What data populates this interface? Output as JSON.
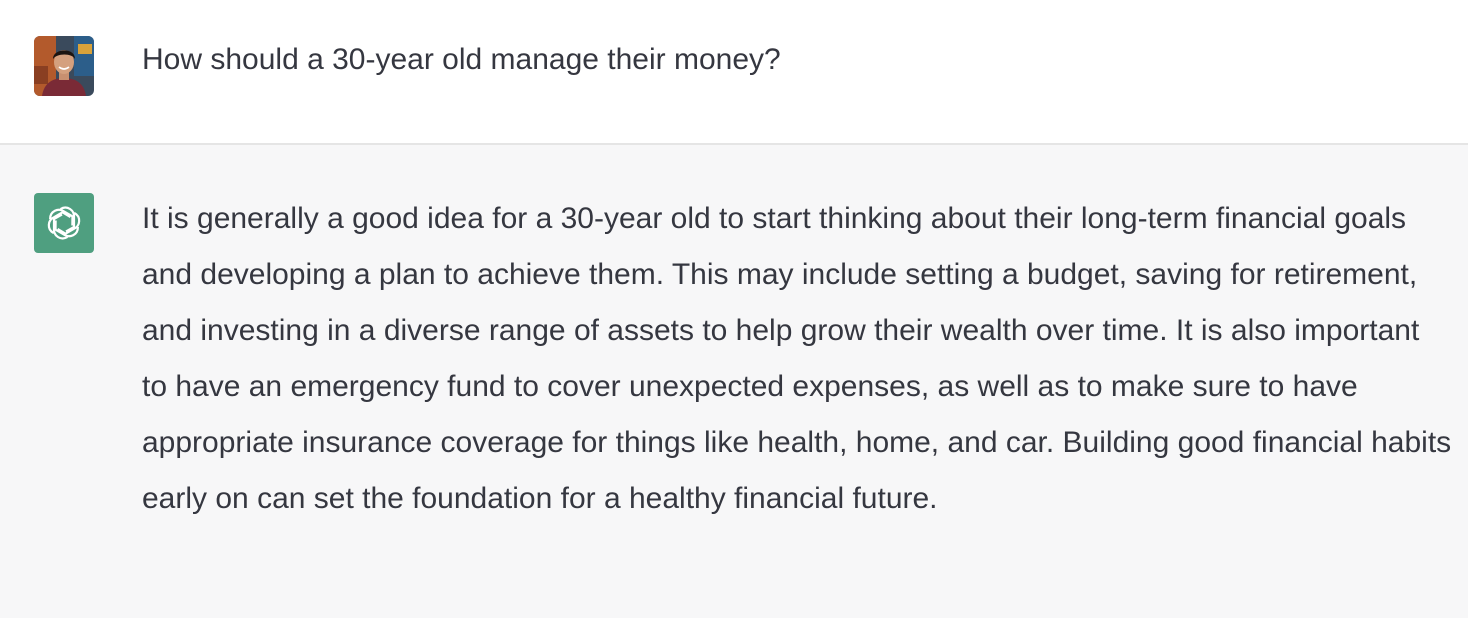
{
  "conversation": {
    "user_message": {
      "avatar": "user-avatar-photo",
      "text": "How should a 30-year old manage their money?"
    },
    "assistant_message": {
      "icon": "openai-logo-icon",
      "icon_bg_color": "#4f9f80",
      "text": "It is generally a good idea for a 30-year old to start thinking about their long-term financial goals and developing a plan to achieve them. This may include setting a budget, saving for retirement, and investing in a diverse range of assets to help grow their wealth over time. It is also important to have an emergency fund to cover unexpected expenses, as well as to make sure to have appropriate insurance coverage for things like health, home, and car. Building good financial habits early on can set the foundation for a healthy financial future."
    }
  },
  "colors": {
    "user_bg": "#ffffff",
    "assistant_bg": "#f7f7f8",
    "text": "#353740",
    "divider": "#e5e5e5"
  }
}
